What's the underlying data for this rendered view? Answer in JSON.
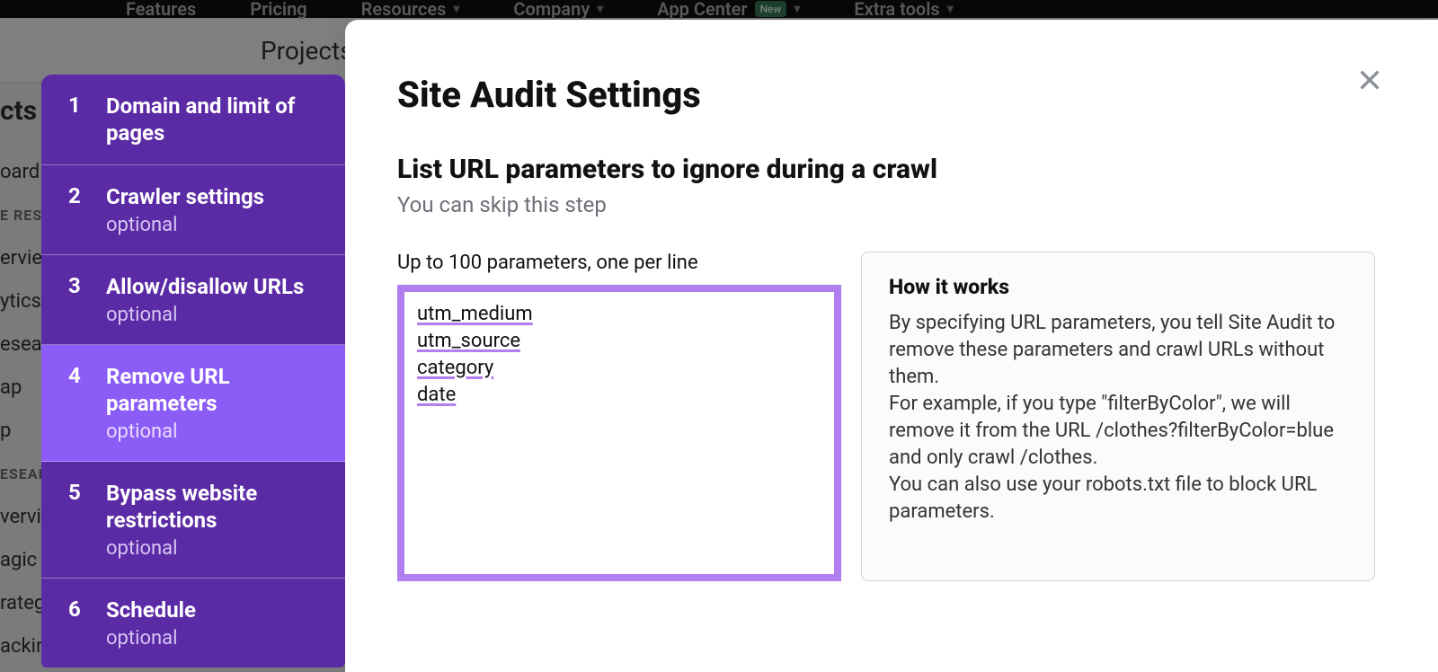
{
  "topnav": {
    "items": [
      {
        "label": "Features"
      },
      {
        "label": "Pricing"
      },
      {
        "label": "Resources",
        "caret": true
      },
      {
        "label": "Company",
        "caret": true
      },
      {
        "label": "App Center",
        "pill": "New",
        "caret": true
      },
      {
        "label": "Extra tools",
        "caret": true
      }
    ]
  },
  "page": {
    "section": "Projects"
  },
  "left_nav_fragments": {
    "items": [
      "cts",
      "oard",
      "E RES",
      "erview",
      "ytics",
      "esearch",
      "ap",
      "p",
      "ESEAF",
      "vervie",
      "agic",
      "rateg",
      "acking"
    ]
  },
  "steps": [
    {
      "n": "1",
      "title": "Domain and limit of pages",
      "optional": false
    },
    {
      "n": "2",
      "title": "Crawler settings",
      "optional": true
    },
    {
      "n": "3",
      "title": "Allow/disallow URLs",
      "optional": true
    },
    {
      "n": "4",
      "title": "Remove URL parameters",
      "optional": true,
      "active": true
    },
    {
      "n": "5",
      "title": "Bypass website restrictions",
      "optional": true
    },
    {
      "n": "6",
      "title": "Schedule",
      "optional": true
    }
  ],
  "optional_label": "optional",
  "modal": {
    "title": "Site Audit Settings",
    "subtitle": "List URL parameters to ignore during a crawl",
    "hint": "You can skip this step",
    "field_label": "Up to 100 parameters, one per line",
    "textarea_value": "utm_medium\nutm_source\ncategory\ndate",
    "info_title": "How it works",
    "info_body": "By specifying URL parameters, you tell Site Audit to remove these parameters and crawl URLs without them.\nFor example, if you type \"filterByColor\", we will remove it from the URL /clothes?filterByColor=blue and only crawl /clothes.\nYou can also use your robots.txt file to block URL parameters."
  }
}
